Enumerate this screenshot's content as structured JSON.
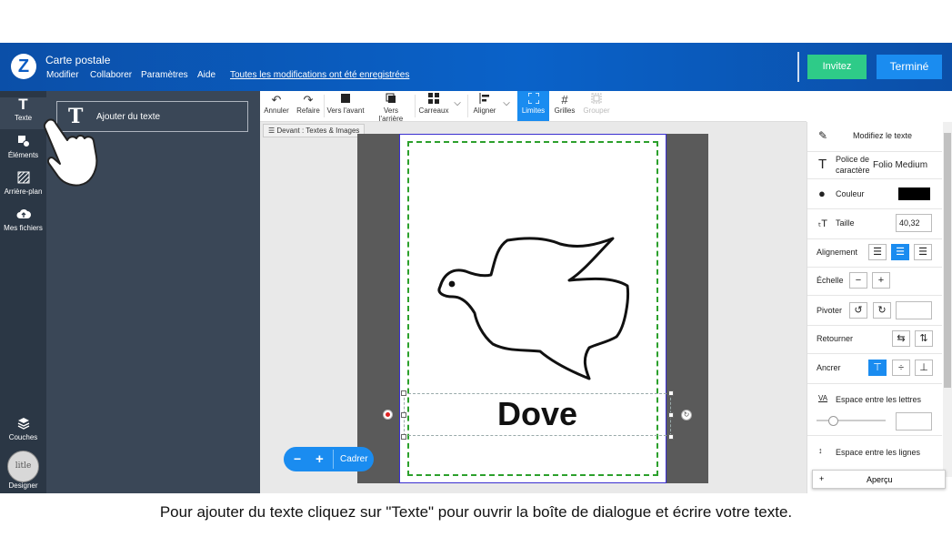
{
  "header": {
    "logo_char": "Z",
    "title": "Carte postale",
    "menu": [
      "Modifier",
      "Collaborer",
      "Paramètres",
      "Aide"
    ],
    "saved_status": "Toutes les modifications ont été enregistrées",
    "invite_label": "Invitez",
    "done_label": "Terminé"
  },
  "leftnav": {
    "items": [
      {
        "label": "Texte",
        "icon": "text-icon"
      },
      {
        "label": "Éléments",
        "icon": "shapes-icon"
      },
      {
        "label": "Arrière-plan",
        "icon": "background-icon"
      },
      {
        "label": "Mes fichiers",
        "icon": "upload-cloud-icon"
      }
    ],
    "layers_label": "Couches",
    "designer_label": "Designer",
    "designer_avatar": "litle"
  },
  "panel": {
    "add_text_label": "Ajouter du texte",
    "add_text_icon": "T"
  },
  "toolbar": {
    "undo": "Annuler",
    "redo": "Refaire",
    "forward": "Vers l'avant",
    "backward": "Vers l'arrière",
    "tiles": "Carreaux",
    "align": "Aligner",
    "limits": "Limites",
    "grids": "Grilles",
    "group": "Grouper"
  },
  "canvas": {
    "side_label": "Devant : Textes & Images",
    "text_content": "Dove",
    "zoom_fit": "Cadrer",
    "zoom_out": "−",
    "zoom_in": "+"
  },
  "properties": {
    "title": "Modifiez le texte",
    "font_label": "Police de caractère",
    "font_value": "Folio Medium",
    "color_label": "Couleur",
    "color_value": "#000000",
    "size_label": "Taille",
    "size_value": "40,32",
    "align_label": "Alignement",
    "scale_label": "Échelle",
    "rotate_label": "Pivoter",
    "flip_label": "Retourner",
    "anchor_label": "Ancrer",
    "letter_spacing_label": "Espace entre les lettres",
    "letter_spacing_icon": "VA",
    "line_spacing_label": "Espace entre les lignes",
    "preview_label": "Aperçu",
    "preview_plus": "+"
  },
  "colors": {
    "accent": "#1a8cf0",
    "invite": "#2ecb88",
    "header": "#0b5cc4",
    "sidebar": "#2b3745",
    "panel": "#3a4757",
    "safe_zone": "#2ca02c"
  },
  "caption": "Pour ajouter du texte cliquez sur \"Texte\" pour ouvrir la boîte de dialogue et écrire votre texte."
}
